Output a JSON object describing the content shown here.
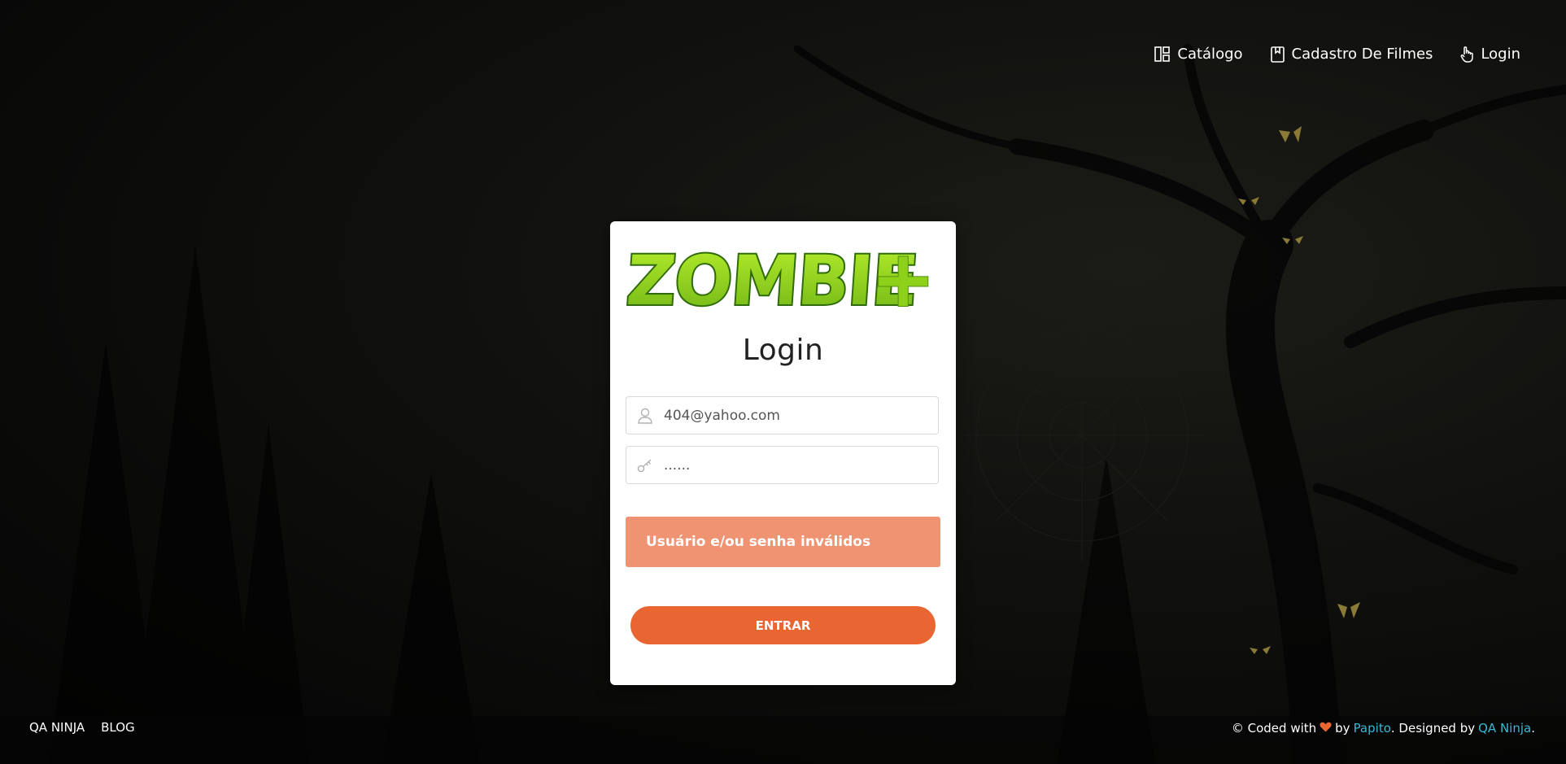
{
  "nav": {
    "items": [
      {
        "label": "Catálogo",
        "icon": "catalog-grid-icon"
      },
      {
        "label": "Cadastro De Filmes",
        "icon": "bookmark-icon"
      },
      {
        "label": "Login",
        "icon": "pointer-hand-icon"
      }
    ]
  },
  "card": {
    "logo_text": "ZOMBIE",
    "logo_plus": "+",
    "title": "Login",
    "email": {
      "value": "404@yahoo.com",
      "icon": "user-icon"
    },
    "password": {
      "value": "......",
      "icon": "key-icon"
    },
    "alert": "Usuário e/ou senha inválidos",
    "submit_label": "ENTRAR"
  },
  "footer": {
    "left_links": [
      "QA NINJA",
      "BLOG"
    ],
    "credit_prefix": "© Coded with",
    "credit_by": "by",
    "author": "Papito",
    "designed_prefix": ". Designed by",
    "designer": "QA Ninja",
    "suffix": "."
  },
  "colors": {
    "accent": "#e96633",
    "alert_bg": "#ef9373",
    "link": "#3ab8d6",
    "logo_green": "#8fd11a",
    "logo_dark_green": "#2f6b0a"
  }
}
